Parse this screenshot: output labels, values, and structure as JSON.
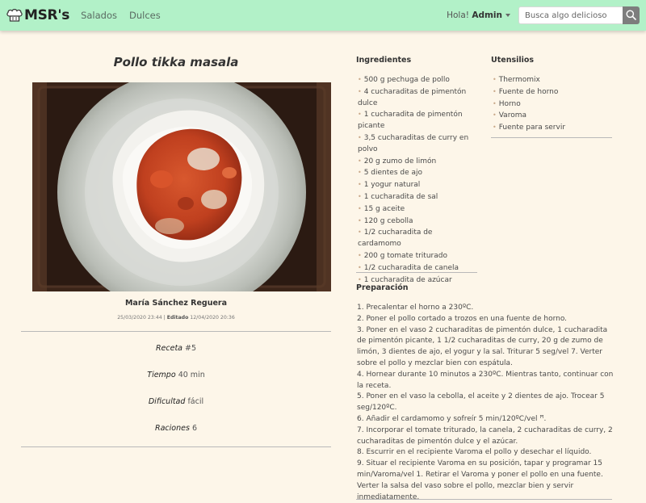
{
  "navbar": {
    "brand": "MSR's",
    "links": [
      "Salados",
      "Dulces"
    ],
    "greeting": "Hola!",
    "user": "Admin",
    "search_placeholder": "Busca algo delicioso",
    "brand_icon": "chef-hat-icon",
    "search_icon": "search-icon"
  },
  "recipe": {
    "title": "Pollo tikka masala",
    "author": "María Sánchez Reguera",
    "created": "25/03/2020 23:44",
    "edited_label": "Editado",
    "edited": "12/04/2020 20:36",
    "meta": [
      {
        "label": "Receta",
        "value": "#5"
      },
      {
        "label": "Tiempo",
        "value": "40 min"
      },
      {
        "label": "Dificultad",
        "value": "fácil"
      },
      {
        "label": "Raciones",
        "value": "6"
      }
    ]
  },
  "ingredients": {
    "title": "Ingredientes",
    "items": [
      "500 g pechuga de pollo",
      "4 cucharaditas de pimentón dulce",
      "1 cucharadita de pimentón picante",
      "3,5 cucharaditas de curry en polvo",
      "20 g zumo de limón",
      "5 dientes de ajo",
      "1 yogur natural",
      "1 cucharadita de sal",
      "15 g aceite",
      "120 g cebolla",
      "1/2 cucharadita de cardamomo",
      "200 g tomate triturado",
      "1/2 cucharadita de canela",
      "1 cucharadita de azúcar"
    ]
  },
  "utensils": {
    "title": "Utensilios",
    "items": [
      "Thermomix",
      "Fuente de horno",
      "Horno",
      "Varoma",
      "Fuente para servir"
    ]
  },
  "preparation": {
    "title": "Preparación",
    "steps": [
      "1. Precalentar el horno a 230ºC.",
      "2. Poner el pollo cortado a trozos en una fuente de horno.",
      "3. Poner en el vaso 2 cucharaditas de pimentón dulce, 1 cucharadita de pimentón picante, 1 1/2 cucharaditas de curry, 20 g de zumo de limón, 3 dientes de ajo, el yogur y la sal. Triturar 5 seg/vel 7. Verter sobre el pollo y mezclar bien con espátula.",
      "4. Hornear durante 10 minutos a 230ºC. Mientras tanto, continuar con la receta.",
      "5. Poner en el vaso la cebolla, el aceite y 2 dientes de ajo. Trocear 5 seg/120ºC.",
      "6. Añadir el cardamomo y sofreír 5 min/120ºC/vel ꟸ.",
      "7. Incorporar el tomate triturado, la canela, 2 cucharaditas de curry, 2 cucharaditas de pimentón dulce y el azúcar.",
      "8. Escurrir en el recipiente Varoma el pollo y desechar el líquido.",
      "9. Situar el recipiente Varoma en su posición, tapar y programar 15 min/Varoma/vel 1. Retirar el Varoma y poner el pollo en una fuente. Verter la salsa del vaso sobre el pollo, mezclar bien y servir inmediatamente."
    ]
  }
}
